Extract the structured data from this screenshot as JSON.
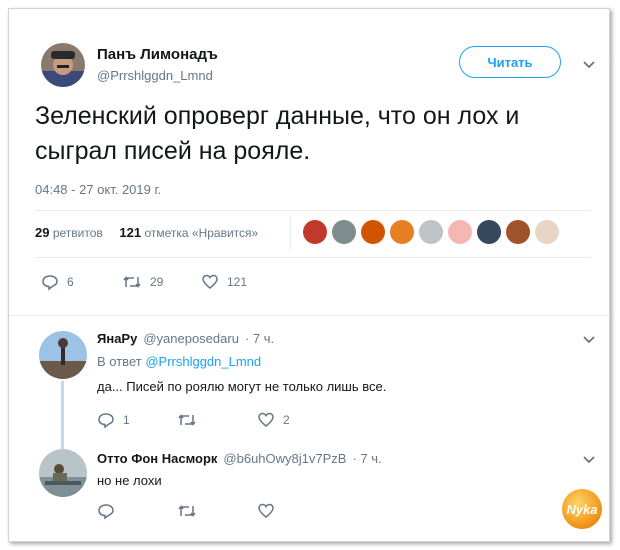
{
  "tweet": {
    "author_name": "Панъ Лимонадъ",
    "author_handle": "@Prrshlggdn_Lmnd",
    "follow_label": "Читать",
    "text": "Зеленский опроверг данные, что он лох и сыграл писей на рояле.",
    "timestamp": "04:48 - 27 окт. 2019 г.",
    "retweets_count": "29",
    "retweets_label": "ретвитов",
    "likes_count": "121",
    "likes_label": "отметка «Нравится»",
    "actions": {
      "replies": "6",
      "retweets": "29",
      "likes": "121"
    },
    "liker_avatar_colors": [
      "#c0392b",
      "#7f8c8d",
      "#d35400",
      "#e67e22",
      "#bdc3c7",
      "#f5b7b1",
      "#34495e",
      "#a0522d",
      "#e8d5c4"
    ]
  },
  "replies": [
    {
      "name": "ЯнаРу",
      "handle": "@yaneposedaru",
      "time": "· 7 ч.",
      "in_reply_prefix": "В ответ",
      "in_reply_handle": "@Prrshlggdn_Lmnd",
      "text": "да... Писей по роялю могут не только лишь все.",
      "actions": {
        "replies": "1",
        "retweets": "",
        "likes": "2"
      }
    },
    {
      "name": "Отто Фон Насморк",
      "handle": "@b6uhOwy8j1v7PzB",
      "time": "· 7 ч.",
      "text": "но не лохи",
      "actions": {
        "replies": "",
        "retweets": "",
        "likes": ""
      }
    }
  ],
  "watermark": {
    "text": "Nyka"
  },
  "colors": {
    "accent": "#1da1f2",
    "secondary_text": "#657786",
    "thread_line": "#b8dcf2"
  }
}
